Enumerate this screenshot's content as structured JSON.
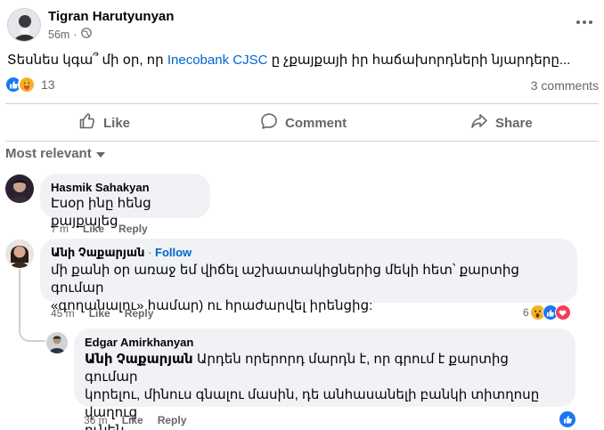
{
  "post": {
    "author": "Tigran Harutyunyan",
    "time": "56m",
    "separator": "·",
    "text_before": "Տեսնես կգա՞ մի օր, որ ",
    "mention": "Inecobank CJSC",
    "text_after": " ը չքայքայի իր հաճախորդների նյարդերը...",
    "reactions_count": "13",
    "comments_count": "3 comments"
  },
  "actions": {
    "like": "Like",
    "comment": "Comment",
    "share": "Share"
  },
  "sort": {
    "label": "Most relevant"
  },
  "comments": [
    {
      "name": "Hasmik Sahakyan",
      "text": "Էսօր ինը հենց քայքայեց",
      "time": "7 m",
      "like": "Like",
      "reply": "Reply"
    },
    {
      "name": "Անի Չաքարյան",
      "dot": " · ",
      "follow": "Follow",
      "line1": "մի քանի օր առաջ եմ վիճել աշխատակիցներից մեկի հետ՝ քարտից գումար",
      "line2": "«գողանալու» համար) ու հրաժարվել իրենցից:",
      "time": "45 m",
      "like": "Like",
      "reply": "Reply",
      "reaction_count": "6"
    },
    {
      "name": "Edgar Amirkhanyan",
      "tag": "Անի Չաքարյան",
      "line1_rest": " Արդեն որերորդ մարդն է, որ գրում է քարտից գումար",
      "line2": "կորելու, մինուս գնալու մասին, դե անհասանելի բանկի տիտղոսը վաղուց",
      "line3": "ունեն",
      "time": "36 m",
      "like": "Like",
      "reply": "Reply"
    }
  ],
  "colors": {
    "link": "#0064d1",
    "secondary_text": "#65676b",
    "bubble_bg": "#f0f2f5",
    "like_blue": "#1877f2",
    "love_red": "#f33e58",
    "care_yellow": "#f7b125"
  }
}
